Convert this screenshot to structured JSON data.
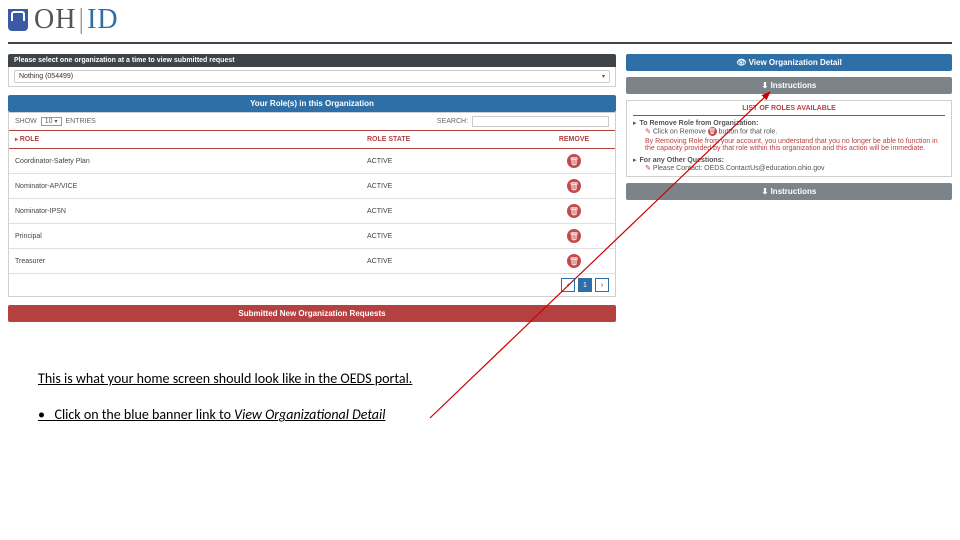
{
  "logo": {
    "oh": "OH",
    "bar": "|",
    "id": "ID"
  },
  "portal": {
    "select_prompt": "Please select one organization at a time to view submitted request",
    "org_selected": "Nothing (054499)",
    "roles_header": "Your Role(s) in this Organization",
    "show_label_pre": "SHOW",
    "show_value": "10",
    "show_label_post": "ENTRIES",
    "search_label": "SEARCH:",
    "columns": {
      "role": "ROLE",
      "state": "ROLE STATE",
      "remove": "REMOVE"
    },
    "rows": [
      {
        "role": "Coordinator-Safety Plan",
        "state": "ACTIVE"
      },
      {
        "role": "Nominator-AP/VICE",
        "state": "ACTIVE"
      },
      {
        "role": "Nominator-IPSN",
        "state": "ACTIVE"
      },
      {
        "role": "Principal",
        "state": "ACTIVE"
      },
      {
        "role": "Treasurer",
        "state": "ACTIVE"
      }
    ],
    "page_current": "1",
    "submitted_header": "Submitted New Organization Requests",
    "view_org_btn": "View Organization Detail",
    "instructions_header": "Instructions",
    "roles_avail": "LIST OF ROLES AVAILABLE",
    "instr": {
      "remove_title": "To Remove Role from Organization:",
      "remove_step": "Click on Remove",
      "remove_step_after": "button for that role.",
      "remove_warn": "By Removing Role from your account, you understand that you no longer be able to function in the capacity provided by that role within this organization and this action will be immediate.",
      "other_q": "For any Other Questions:",
      "contact": "Please Contact: OEDS.ContactUs@education.ohio.gov"
    }
  },
  "annotation": {
    "line1": "This is what your home screen should look like in the OEDS portal.",
    "bullet": "•",
    "line2_a": "Click on the blue banner link to ",
    "line2_b": "View Organizational Detail"
  }
}
